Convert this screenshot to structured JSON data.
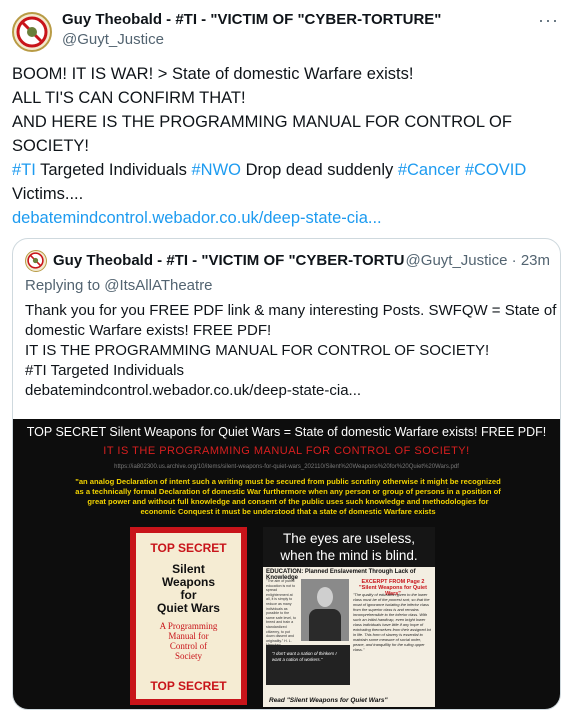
{
  "tweet": {
    "display_name": "Guy Theobald - #TI - \"VICTIM OF \"CYBER-TORTURE\"",
    "handle": "@Guyt_Justice",
    "more_label": "···",
    "lines": [
      "BOOM! IT IS WAR! > State of domestic Warfare exists!",
      "ALL TI'S CAN CONFIRM THAT!",
      "AND HERE IS THE PROGRAMMING MANUAL FOR CONTROL OF",
      "SOCIETY!"
    ],
    "hashtags": [
      "#TI",
      "#NWO",
      "#Cancer",
      "#COVID"
    ],
    "text_targeted": " Targeted Individuals ",
    "text_drop_dead": " Drop dead suddenly ",
    "text_victims": "Victims....",
    "link": "debatemindcontrol.webador.co.uk/deep-state-cia..."
  },
  "quote": {
    "display_name": "Guy Theobald - #TI - \"VICTIM OF \"CYBER-TORTURE",
    "handle": "@Guyt_Justice",
    "time": "· 23m",
    "replying": "Replying to @ItsAllATheatre",
    "body_lines": [
      "Thank you for you FREE PDF link & many interesting Posts. SWFQW = State of",
      "domestic Warfare exists! FREE PDF!",
      "IT IS THE PROGRAMMING MANUAL FOR CONTROL OF SOCIETY!",
      "#TI Targeted Individuals",
      "debatemindcontrol.webador.co.uk/deep-state-cia..."
    ]
  },
  "media": {
    "title": "TOP SECRET Silent Weapons for Quiet Wars =  State of domestic Warfare exists! FREE PDF!",
    "subtitle": "IT IS THE PROGRAMMING MANUAL FOR CONTROL OF SOCIETY!",
    "url": "https://ia802300.us.archive.org/10/items/silent-weapons-for-quiet-wars_202110/Silent%20Weapons%20for%20Quiet%20Wars.pdf",
    "quote_text": "\"an analog Declaration of intent such a writing must be secured from public scrutiny otherwise it might be recognized as a technically formal Declaration of domestic War furthermore when any person or group of persons in a position of great power and without full knowledge and consent of the public uses such knowledge and methodologies for economic Conquest it must be understood that a state of domestic Warfare exists",
    "book": {
      "top": "TOP SECRET",
      "title_lines": [
        "Silent",
        "Weapons",
        "for",
        "Quiet Wars"
      ],
      "subtitle_lines": [
        "A Programming",
        "Manual for",
        "Control of",
        "Society"
      ],
      "bottom": "TOP SECRET"
    },
    "poster": {
      "headline_1": "The eyes are useless,",
      "headline_2": "when the mind is blind.",
      "education": "EDUCATION: Planned Enslavement Through Lack of Knowledge",
      "left_col": "\"The aim of public education is not to spread enlightenment at all, it is simply to reduce as many individuals as possible to the same safe level, to breed and train a standardized citizenry, to put down dissent and originality.\" H. L. Mencken",
      "excerpt_title": "EXCERPT FROM Page 2 \"Silent Weapons for Quiet Wars\"",
      "excerpt": "\"The quality of education given to the lower class must be of the poorest sort, so that the moat of ignorance isolating the inferior class from the superior class is and remains incomprehensible to the inferior class. With such an initial handicap, even bright lower class individuals have little if any hope of extricating themselves from their assigned lot in life. This form of slavery is essential to maintain some measure of social order, peace, and tranquillity for the ruling upper class.\"",
      "dark_quote": "\"I don't want a nation of thinkers I want a nation of workers.\"",
      "footer": "Read \"Silent Weapons for Quiet Wars\""
    }
  },
  "colors": {
    "link": "#1d9bf0",
    "secondary_text": "#536471",
    "book_red": "#c8141a",
    "quote_yellow": "#f2d300"
  }
}
